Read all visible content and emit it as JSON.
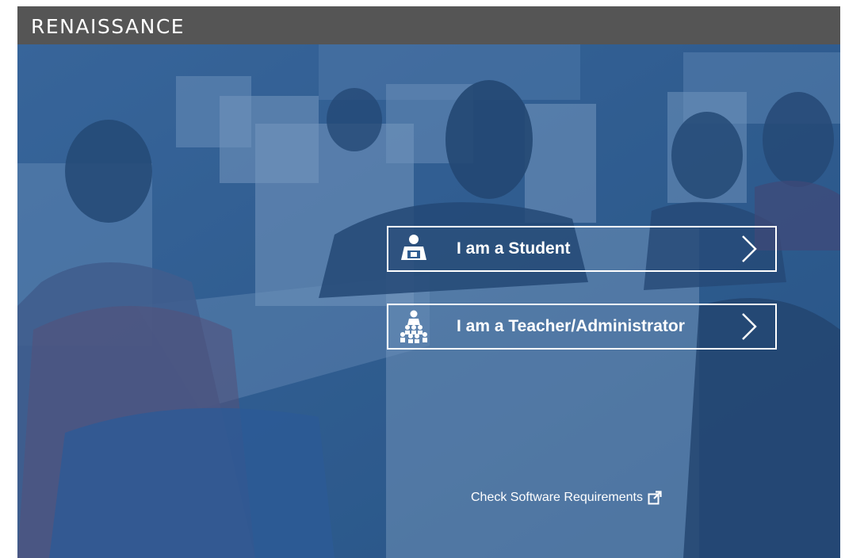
{
  "header": {
    "brand": "RENAISSANCE"
  },
  "roles": [
    {
      "label": "I am a Student",
      "icon": "student-icon"
    },
    {
      "label": "I am a Teacher/Administrator",
      "icon": "teacher-admin-icon"
    }
  ],
  "footer_link": {
    "label": "Check Software Requirements",
    "icon": "external-link-icon"
  },
  "colors": {
    "topbar": "#555555",
    "overlay": "#2f5d92",
    "text": "#ffffff"
  }
}
